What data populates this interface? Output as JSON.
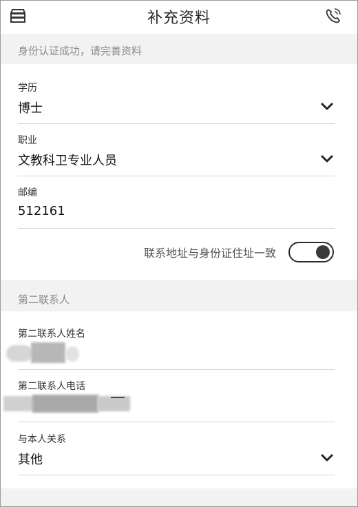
{
  "header": {
    "title": "补充资料",
    "left_icon": "menu-icon",
    "right_icon": "phone-icon"
  },
  "identity_banner": {
    "text": "身份认证成功，请完善资料"
  },
  "education": {
    "label": "学历",
    "value": "博士"
  },
  "occupation": {
    "label": "职业",
    "value": "文教科卫专业人员"
  },
  "postcode": {
    "label": "邮编",
    "value": "512161"
  },
  "address_toggle": {
    "label": "联系地址与身份证住址一致",
    "on": true
  },
  "second_contact_banner": {
    "text": "第二联系人"
  },
  "second_contact_name": {
    "label": "第二联系人姓名"
  },
  "second_contact_phone": {
    "label": "第二联系人电话"
  },
  "relationship": {
    "label": "与本人关系",
    "value": "其他"
  },
  "colors": {
    "banner_bg": "#f2f2f2",
    "divider": "#d6d6d6",
    "text": "#111111",
    "muted": "#8a8a8a"
  }
}
